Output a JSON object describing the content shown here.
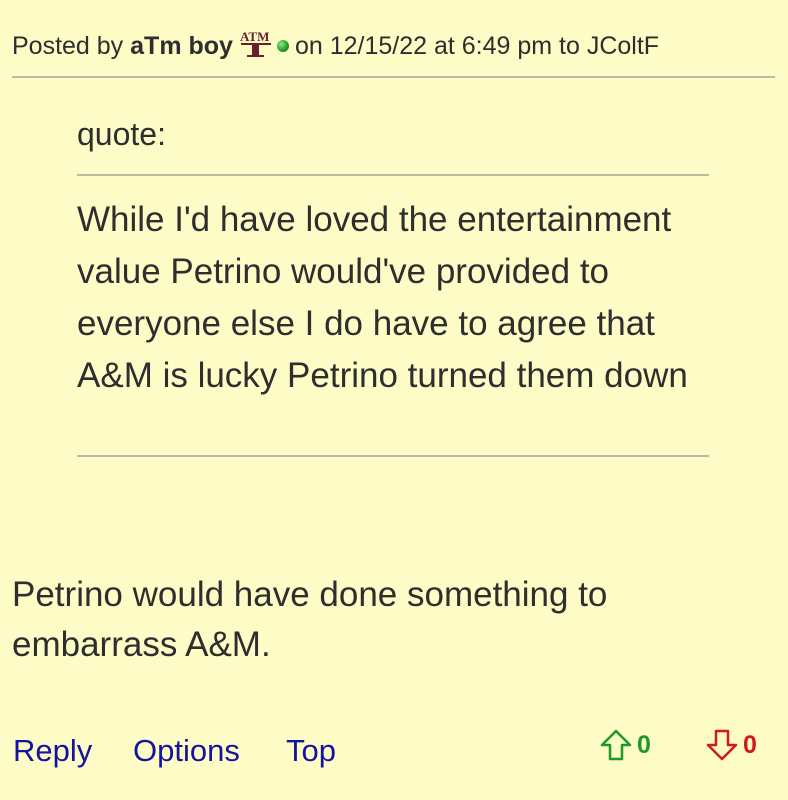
{
  "header": {
    "posted_by_label": "Posted by",
    "author": "aTm boy",
    "team_logo_text": "ATM",
    "date_text": "on 12/15/22 at 6:49 pm to",
    "reply_to": "JColtF"
  },
  "quote": {
    "label": "quote:",
    "text": "While I'd have loved the entertainment value Petrino would've provided to everyone else I do have to agree that A&M is lucky Petrino turned them down"
  },
  "body": {
    "text": "Petrino would have done something to embarrass A&M."
  },
  "footer": {
    "reply_label": "Reply",
    "options_label": "Options",
    "top_label": "Top",
    "upvotes": "0",
    "downvotes": "0"
  },
  "colors": {
    "background": "#fdfbc6",
    "link": "#14149e",
    "upvote": "#1e9a2a",
    "downvote": "#d11a1a",
    "logo_maroon": "#6a1f2e"
  },
  "icons": {
    "online_status": "online-dot-icon",
    "team_logo": "texas-am-logo-icon",
    "upvote": "arrow-up-icon",
    "downvote": "arrow-down-icon"
  }
}
